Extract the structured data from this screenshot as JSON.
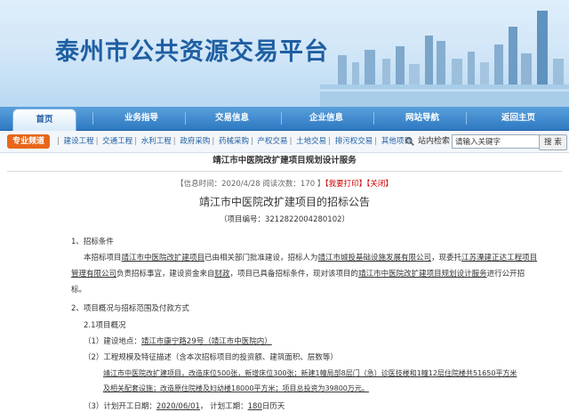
{
  "banner": {
    "title": "泰州市公共资源交易平台"
  },
  "nav": {
    "items": [
      "首页",
      "业务指导",
      "交易信息",
      "企业信息",
      "网站导航",
      "返回主页"
    ],
    "active_index": 0
  },
  "quick": {
    "tag": "专业频道",
    "links": [
      "建设工程",
      "交通工程",
      "水利工程",
      "政府采购",
      "药械采购",
      "产权交易",
      "土地交易",
      "排污权交易",
      "其他项目"
    ],
    "search_label": "站内检索",
    "search_value": "请输入关键字",
    "search_button": "搜 索"
  },
  "page": {
    "breadcrumb": "靖江市中医院改扩建项目规划设计服务",
    "meta_prefix": "【信息时间：2020/4/28  阅读次数：170 】",
    "find_print": "【我要打印】",
    "close": "【关闭】",
    "title": "靖江市中医院改扩建项目的招标公告",
    "project_no": "（项目编号：3212822004280102）"
  },
  "body": {
    "s1": "1、招标条件",
    "p1_a": "本招标项目",
    "p1_proj": "靖江市中医院改扩建项目",
    "p1_b": "已由相关部门批准建设，招标人为",
    "p1_owner": "靖江市城投基础设施发展有限公司",
    "p1_c": "，现委托",
    "p1_agent_a": "江苏溧建正达工程项目",
    "p1_agent_b": "管理有限公司",
    "p1_d": "负责招标事宜，建设资金来自",
    "p1_fund": "财政",
    "p1_e": "，项目已具备招标条件，现对该项目的",
    "p1_target": "靖江市中医院改扩建项目规划设计服务",
    "p1_f": "进行公开招",
    "p1_g": "标。",
    "s2": "2、项目概况与招标范围及付款方式",
    "s21": "2.1项目概况",
    "l1_a": "（1）建设地点：",
    "l1_v": "靖江市康宁路29号（靖江市中医院内）",
    "l2": "（2）工程规模及特征描述（含本次招标项目的投资额、建筑面积、层数等）",
    "l2_v1": "靖江市中医院改扩建项目，改造床位500张，新增床位300张；新建1幢局部8层门（急）诊医技楼和1幢12层住院楼共51650平方米",
    "l2_v2": "及相关配套设施；改造原住院楼及妇幼楼18000平方米；项目总投资为39800万元。",
    "l3_a": "（3）计划开工日期：",
    "l3_date": "2020/06/01",
    "l3_b": "，  计划工期：",
    "l3_days": "180",
    "l3_c": "日历天"
  }
}
